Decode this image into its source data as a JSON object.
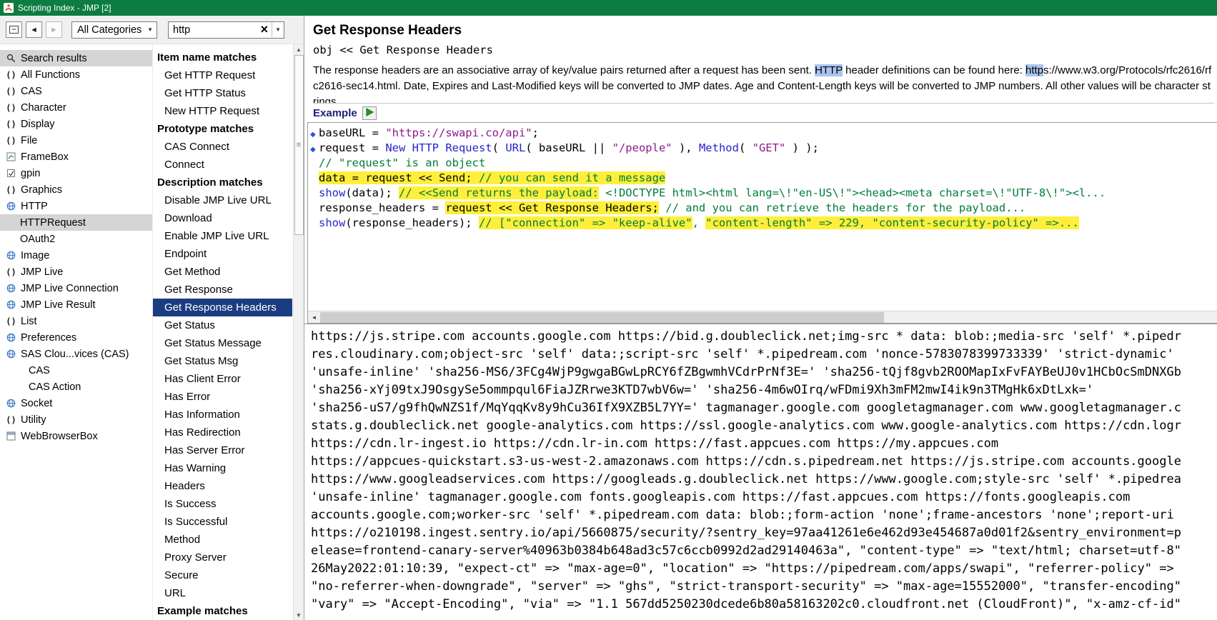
{
  "window": {
    "title": "Scripting Index - JMP [2]"
  },
  "colors": {
    "titlebar_green": "#0d7c41",
    "selection_navy": "#1b3c80",
    "row_gray": "#d5d5d5",
    "highlighter_yellow": "#ffef3a",
    "search_hit_blue": "#a9c4ee",
    "keyword_blue": "#2626cc",
    "string_purple": "#8e1a8e",
    "comment_green": "#007d3c"
  },
  "toolbar": {
    "category_value": "All Categories",
    "search_value": "http",
    "icons": [
      "collapse-icon",
      "back-arrow-icon",
      "forward-arrow-icon",
      "chevron-down-icon",
      "clear-search-icon",
      "search-dropdown-icon"
    ]
  },
  "sidebar": {
    "items": [
      {
        "label": "Search results",
        "icon": "search",
        "indent": 0,
        "state": "current"
      },
      {
        "label": "All Functions",
        "icon": "fn",
        "indent": 0
      },
      {
        "label": "CAS",
        "icon": "fn",
        "indent": 0
      },
      {
        "label": "Character",
        "icon": "fn",
        "indent": 0
      },
      {
        "label": "Display",
        "icon": "fn",
        "indent": 0
      },
      {
        "label": "File",
        "icon": "fn",
        "indent": 0
      },
      {
        "label": "FrameBox",
        "icon": "box",
        "indent": 0
      },
      {
        "label": "gpin",
        "icon": "check",
        "indent": 0
      },
      {
        "label": "Graphics",
        "icon": "fn",
        "indent": 0
      },
      {
        "label": "HTTP",
        "icon": "obj",
        "indent": 0
      },
      {
        "label": "HTTPRequest",
        "icon": "none",
        "indent": 1,
        "state": "active"
      },
      {
        "label": "OAuth2",
        "icon": "none",
        "indent": 1
      },
      {
        "label": "Image",
        "icon": "obj",
        "indent": 0
      },
      {
        "label": "JMP Live",
        "icon": "fn",
        "indent": 0
      },
      {
        "label": "JMP Live Connection",
        "icon": "obj",
        "indent": 0
      },
      {
        "label": "JMP Live Result",
        "icon": "obj",
        "indent": 0
      },
      {
        "label": "List",
        "icon": "fn",
        "indent": 0
      },
      {
        "label": "Preferences",
        "icon": "obj",
        "indent": 0
      },
      {
        "label": "SAS Clou...vices (CAS)",
        "icon": "obj",
        "indent": 0
      },
      {
        "label": "CAS",
        "icon": "none",
        "indent": 2
      },
      {
        "label": "CAS Action",
        "icon": "none",
        "indent": 2
      },
      {
        "label": "Socket",
        "icon": "obj",
        "indent": 0
      },
      {
        "label": "Utility",
        "icon": "fn",
        "indent": 0
      },
      {
        "label": "WebBrowserBox",
        "icon": "webbox",
        "indent": 0
      }
    ]
  },
  "results": {
    "rows": [
      {
        "label": "Item name matches",
        "type": "header"
      },
      {
        "label": "Get HTTP Request",
        "type": "item"
      },
      {
        "label": "Get HTTP Status",
        "type": "item"
      },
      {
        "label": "New HTTP Request",
        "type": "item"
      },
      {
        "label": "Prototype matches",
        "type": "header"
      },
      {
        "label": "CAS Connect",
        "type": "item"
      },
      {
        "label": "Connect",
        "type": "item"
      },
      {
        "label": "Description matches",
        "type": "header"
      },
      {
        "label": "Disable JMP Live URL",
        "type": "item"
      },
      {
        "label": "Download",
        "type": "item"
      },
      {
        "label": "Enable JMP Live URL",
        "type": "item"
      },
      {
        "label": "Endpoint",
        "type": "item"
      },
      {
        "label": "Get Method",
        "type": "item"
      },
      {
        "label": "Get Response",
        "type": "item"
      },
      {
        "label": "Get Response Headers",
        "type": "item",
        "selected": true
      },
      {
        "label": "Get Status",
        "type": "item"
      },
      {
        "label": "Get Status Message",
        "type": "item"
      },
      {
        "label": "Get Status Msg",
        "type": "item"
      },
      {
        "label": "Has Client Error",
        "type": "item"
      },
      {
        "label": "Has Error",
        "type": "item"
      },
      {
        "label": "Has Information",
        "type": "item"
      },
      {
        "label": "Has Redirection",
        "type": "item"
      },
      {
        "label": "Has Server Error",
        "type": "item"
      },
      {
        "label": "Has Warning",
        "type": "item"
      },
      {
        "label": "Headers",
        "type": "item"
      },
      {
        "label": "Is Success",
        "type": "item"
      },
      {
        "label": "Is Successful",
        "type": "item"
      },
      {
        "label": "Method",
        "type": "item"
      },
      {
        "label": "Proxy Server",
        "type": "item"
      },
      {
        "label": "Secure",
        "type": "item"
      },
      {
        "label": "URL",
        "type": "item"
      },
      {
        "label": "Example matches",
        "type": "header"
      }
    ]
  },
  "detail": {
    "title": "Get Response Headers",
    "signature": "obj << Get Response Headers",
    "description": [
      {
        "t": "The response headers are an associative array of key/value pairs returned after a request has been sent. "
      },
      {
        "t": "HTTP",
        "hl": true
      },
      {
        "t": " header definitions can be found here: "
      },
      {
        "t": "http",
        "hl": true
      },
      {
        "t": "s://www.w3.org/Protocols/rfc2616/rfc2616-sec14.html. Date, Expires and Last-Modified keys will be converted to JMP dates. Age and Content-Length keys will be converted to JMP numbers. All other values will be character strings."
      }
    ],
    "example_label": "Example",
    "code": [
      {
        "marker": true,
        "segs": [
          [
            "baseURL = ",
            "p"
          ],
          [
            "\"https://swapi.co/api\"",
            "s"
          ],
          [
            ";",
            "p"
          ]
        ]
      },
      {
        "marker": true,
        "segs": [
          [
            "request = ",
            "p"
          ],
          [
            "New HTTP Request",
            "k"
          ],
          [
            "( ",
            "p"
          ],
          [
            "URL",
            "k"
          ],
          [
            "( baseURL || ",
            "p"
          ],
          [
            "\"/people\"",
            "s"
          ],
          [
            " ), ",
            "p"
          ],
          [
            "Method",
            "k"
          ],
          [
            "( ",
            "p"
          ],
          [
            "\"GET\"",
            "s"
          ],
          [
            " ) );",
            "p"
          ]
        ]
      },
      {
        "segs": [
          [
            "// \"request\" is an object",
            "c"
          ]
        ]
      },
      {
        "segs": [
          [
            "data = request << Send; ",
            "ph"
          ],
          [
            "// you can send it a message",
            "ch"
          ]
        ]
      },
      {
        "segs": [
          [
            "show",
            "k"
          ],
          [
            "(data); ",
            "p"
          ],
          [
            "// <<Send returns the payload:",
            "ch"
          ],
          [
            " <!DOCTYPE html><html lang=\\!\"en-US\\!\"><head><meta charset=\\!\"UTF-8\\!\"><l...",
            "c"
          ]
        ]
      },
      {
        "segs": [
          [
            "response_headers = ",
            "p"
          ],
          [
            "request << Get Response Headers;",
            "ph"
          ],
          [
            " // and you can retrieve the headers for the payload...",
            "c"
          ]
        ]
      },
      {
        "segs": [
          [
            "show",
            "k"
          ],
          [
            "(response_headers); ",
            "p"
          ],
          [
            "// [\"connection\" => \"keep-alive\"",
            "ch"
          ],
          [
            ", ",
            "c"
          ],
          [
            "\"content-length\" => 229, \"content-security-policy\" =>...",
            "ch"
          ]
        ]
      }
    ],
    "output": [
      "https://js.stripe.com accounts.google.com https://bid.g.doubleclick.net;img-src * data: blob:;media-src 'self' *.pipedr",
      "res.cloudinary.com;object-src 'self' data:;script-src 'self' *.pipedream.com 'nonce-5783078399733339' 'strict-dynamic'",
      "'unsafe-inline' 'sha256-MS6/3FCg4WjP9gwgaBGwLpRCY6fZBgwmhVCdrPrNf3E=' 'sha256-tQjf8gvb2ROOMapIxFvFAYBeUJ0v1HCbOcSmDNXGb",
      "'sha256-xYj09txJ9OsgySe5ommpqul6FiaJZRrwe3KTD7wbV6w=' 'sha256-4m6wOIrq/wFDmi9Xh3mFM2mwI4ik9n3TMgHk6xDtLxk='",
      "'sha256-uS7/g9fhQwNZS1f/MqYqqKv8y9hCu36IfX9XZB5L7YY=' tagmanager.google.com googletagmanager.com www.googletagmanager.c",
      "stats.g.doubleclick.net google-analytics.com https://ssl.google-analytics.com www.google-analytics.com https://cdn.logr",
      "https://cdn.lr-ingest.io https://cdn.lr-in.com https://fast.appcues.com https://my.appcues.com",
      "https://appcues-quickstart.s3-us-west-2.amazonaws.com https://cdn.s.pipedream.net https://js.stripe.com accounts.google",
      "https://www.googleadservices.com https://googleads.g.doubleclick.net https://www.google.com;style-src 'self' *.pipedrea",
      "'unsafe-inline' tagmanager.google.com fonts.googleapis.com https://fast.appcues.com https://fonts.googleapis.com",
      "accounts.google.com;worker-src 'self' *.pipedream.com data: blob:;form-action 'none';frame-ancestors 'none';report-uri",
      "https://o210198.ingest.sentry.io/api/5660875/security/?sentry_key=97aa41261e6e462d93e454687a0d01f2&sentry_environment=p",
      "elease=frontend-canary-server%40963b0384b648ad3c57c6ccb0992d2ad29140463a\", \"content-type\" => \"text/html; charset=utf-8\"",
      "26May2022:01:10:39, \"expect-ct\" => \"max-age=0\", \"location\" => \"https://pipedream.com/apps/swapi\", \"referrer-policy\" =>",
      "\"no-referrer-when-downgrade\", \"server\" => \"ghs\", \"strict-transport-security\" => \"max-age=15552000\", \"transfer-encoding\"",
      "\"vary\" => \"Accept-Encoding\", \"via\" => \"1.1 567dd5250230dcede6b80a58163202c0.cloudfront.net (CloudFront)\", \"x-amz-cf-id\""
    ]
  }
}
